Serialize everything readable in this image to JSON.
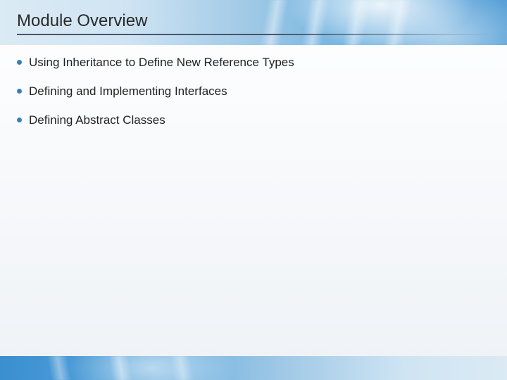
{
  "title": "Module Overview",
  "bullets": [
    "Using Inheritance to Define New Reference Types",
    "Defining and Implementing Interfaces",
    "Defining Abstract Classes"
  ],
  "colors": {
    "bullet": "#3a7fb5",
    "band_start": "#dbeaf4",
    "band_end": "#3a8fd0"
  }
}
